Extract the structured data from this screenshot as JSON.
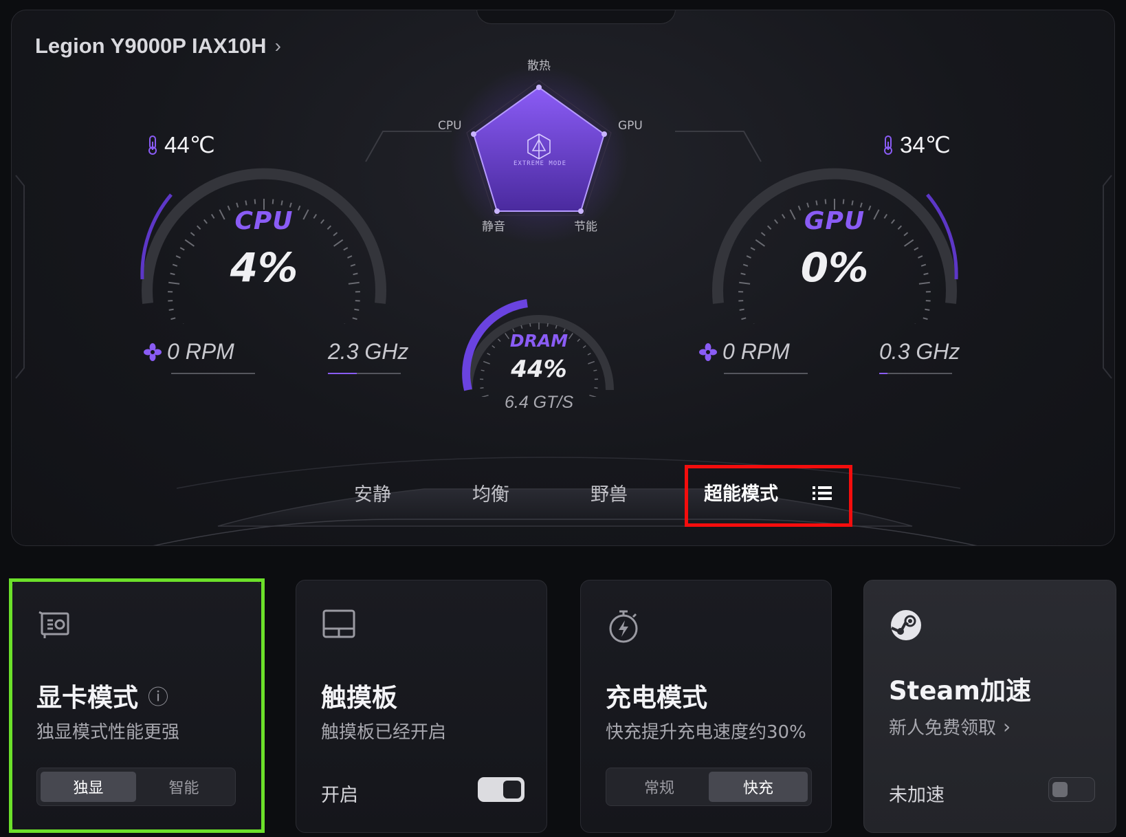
{
  "header": {
    "device_name": "Legion Y9000P IAX10H",
    "chevron": "›"
  },
  "cpu": {
    "label": "CPU",
    "usage": "4%",
    "usage_value": 4,
    "temp": "44℃",
    "fan": "0 RPM",
    "freq": "2.3 GHz"
  },
  "gpu": {
    "label": "GPU",
    "usage": "0%",
    "usage_value": 0,
    "temp": "34℃",
    "fan": "0 RPM",
    "freq": "0.3 GHz"
  },
  "dram": {
    "label": "DRAM",
    "usage": "44%",
    "usage_value": 44,
    "speed": "6.4 GT/S"
  },
  "radar": {
    "top": "散热",
    "left": "CPU",
    "right": "GPU",
    "bottom_left": "静音",
    "bottom_right": "节能",
    "center_label": "EXTREME MODE"
  },
  "modes": {
    "items": [
      "安静",
      "均衡",
      "野兽",
      "超能模式"
    ],
    "active": "超能模式"
  },
  "cards": {
    "gpu_mode": {
      "title": "显卡模式",
      "info_icon": "ⓘ",
      "subtitle": "独显模式性能更强",
      "options": [
        "独显",
        "智能"
      ],
      "selected": "独显"
    },
    "touchpad": {
      "title": "触摸板",
      "subtitle": "触摸板已经开启",
      "toggle_label": "开启",
      "toggle_on": true
    },
    "charge_mode": {
      "title": "充电模式",
      "subtitle": "快充提升充电速度约30%",
      "options": [
        "常规",
        "快充"
      ],
      "selected": "快充"
    },
    "steam": {
      "title": "Steam加速",
      "subtitle": "新人免费领取",
      "subtitle_chevron": "›",
      "toggle_label": "未加速",
      "toggle_on": false
    }
  },
  "colors": {
    "accent_purple": "#8a5cf5",
    "highlight_red": "#f40d0d",
    "highlight_green": "#6ce02a"
  }
}
